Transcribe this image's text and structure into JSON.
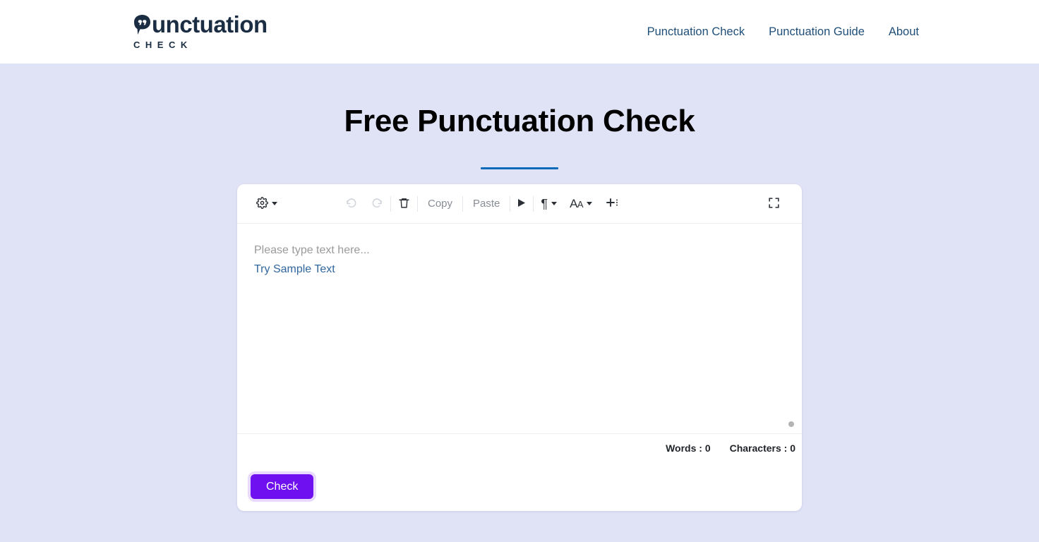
{
  "header": {
    "logo": {
      "word": "unctuation",
      "subtitle": "CHECK",
      "bubble_icon": "speech-bubble-quote-icon"
    },
    "nav": [
      {
        "label": "Punctuation Check"
      },
      {
        "label": "Punctuation Guide"
      },
      {
        "label": "About"
      }
    ]
  },
  "hero": {
    "title": "Free Punctuation Check"
  },
  "editor": {
    "toolbar": {
      "settings": {
        "icon": "gear-icon",
        "label": ""
      },
      "undo": {
        "icon": "undo-icon",
        "label": "",
        "disabled": true
      },
      "redo": {
        "icon": "redo-icon",
        "label": "",
        "disabled": true
      },
      "clear": {
        "icon": "trash-icon",
        "label": ""
      },
      "copy": {
        "label": "Copy"
      },
      "paste": {
        "label": "Paste"
      },
      "speak": {
        "icon": "play-icon",
        "label": ""
      },
      "paragraph": {
        "icon": "pilcrow-icon",
        "label": "¶"
      },
      "font_size": {
        "icon": "font-size-icon",
        "label_large": "A",
        "label_small": "A"
      },
      "insert": {
        "icon": "plus-more-icon",
        "label": ""
      },
      "fullscreen": {
        "icon": "fullscreen-icon",
        "label": ""
      }
    },
    "placeholder": "Please type text here...",
    "sample_link": "Try Sample Text",
    "resize_handle": "resize-handle-icon",
    "counts": {
      "words": "Words : 0",
      "characters": "Characters : 0"
    },
    "check_button": "Check"
  },
  "colors": {
    "page_background": "#e0e3f6",
    "header_background": "#ffffff",
    "brand": "#1b2d42",
    "nav_link": "#1f4e79",
    "title_rule": "#0b6bba",
    "link": "#31679e",
    "primary_button": "#6f10f0",
    "placeholder_text": "#9a9a9a"
  }
}
